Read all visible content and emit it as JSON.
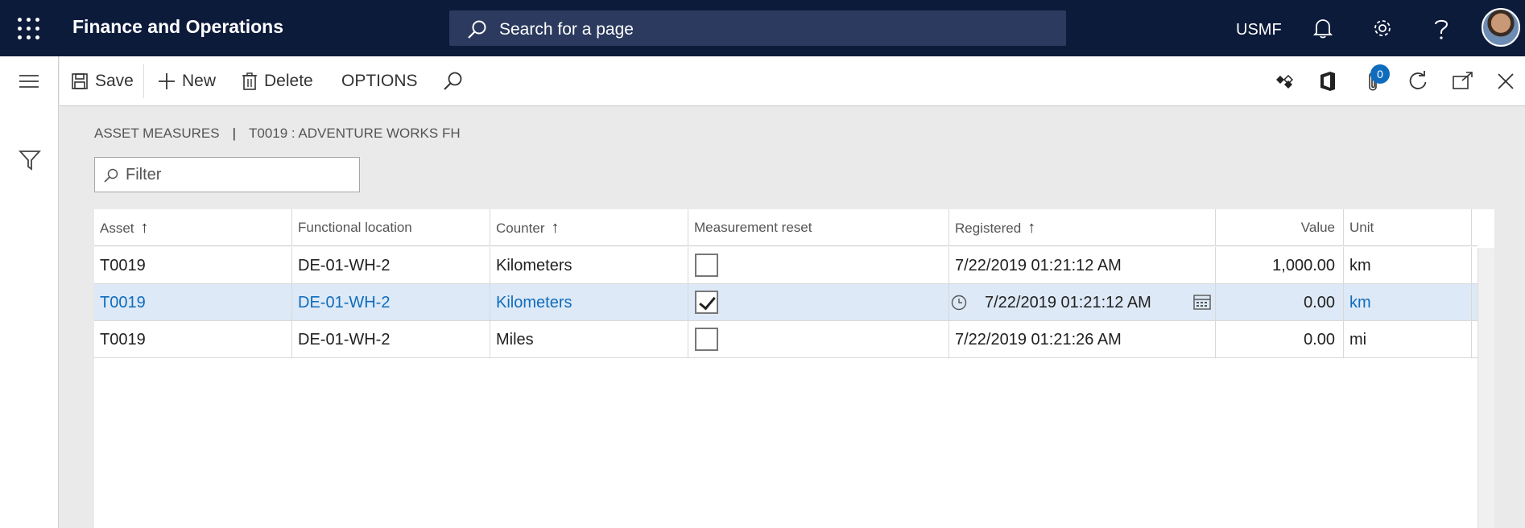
{
  "navbar": {
    "app_title": "Finance and Operations",
    "search_placeholder": "Search for a page",
    "company": "USMF",
    "icons": [
      "waffle-icon",
      "bell-icon",
      "gear-icon",
      "help-icon",
      "avatar"
    ]
  },
  "actionbar": {
    "save": "Save",
    "new": "New",
    "delete": "Delete",
    "options": "OPTIONS",
    "attachment_count": "0",
    "right_icons": [
      "diamond-icon",
      "office-icon",
      "paperclip-icon",
      "refresh-icon",
      "popout-icon",
      "close-icon"
    ]
  },
  "breadcrumb": {
    "page": "ASSET MEASURES",
    "separator": "|",
    "record": "T0019 : ADVENTURE WORKS FH"
  },
  "filter": {
    "placeholder": "Filter"
  },
  "grid": {
    "columns": [
      {
        "label": "Asset",
        "sorted": true
      },
      {
        "label": "Functional location",
        "sorted": false
      },
      {
        "label": "Counter",
        "sorted": true
      },
      {
        "label": "Measurement reset",
        "sorted": false
      },
      {
        "label": "Registered",
        "sorted": true
      },
      {
        "label": "Value",
        "sorted": false
      },
      {
        "label": "Unit",
        "sorted": false
      }
    ],
    "rows": [
      {
        "asset": "T0019",
        "functional_location": "DE-01-WH-2",
        "counter": "Kilometers",
        "measurement_reset": false,
        "registered": "7/22/2019 01:21:12 AM",
        "value": "1,000.00",
        "unit": "km",
        "selected": false
      },
      {
        "asset": "T0019",
        "functional_location": "DE-01-WH-2",
        "counter": "Kilometers",
        "measurement_reset": true,
        "registered": "7/22/2019 01:21:12 AM",
        "value": "0.00",
        "unit": "km",
        "selected": true
      },
      {
        "asset": "T0019",
        "functional_location": "DE-01-WH-2",
        "counter": "Miles",
        "measurement_reset": false,
        "registered": "7/22/2019 01:21:26 AM",
        "value": "0.00",
        "unit": "mi",
        "selected": false
      }
    ]
  },
  "colors": {
    "navbar": "#0d1b3b",
    "accent": "#0f6cbd",
    "selected_row": "#dde9f6"
  }
}
